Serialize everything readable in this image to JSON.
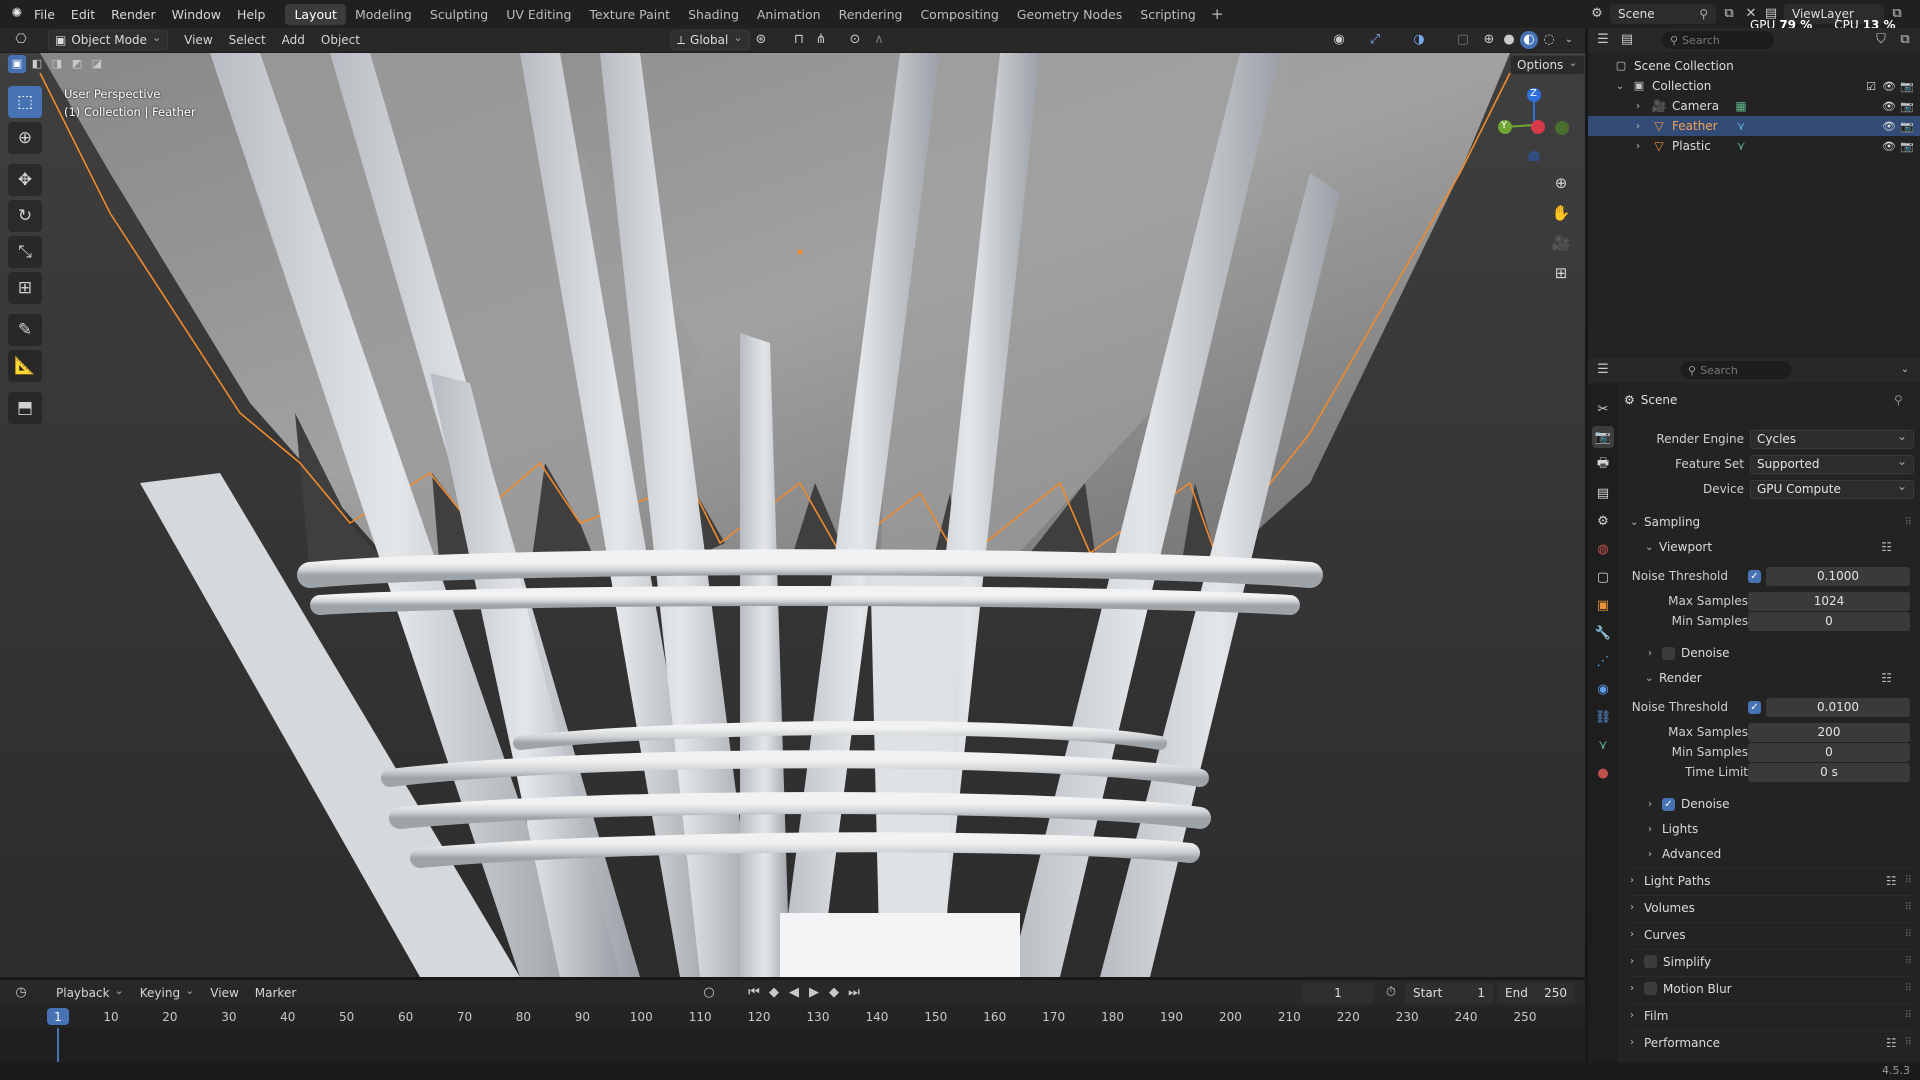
{
  "menu": [
    "File",
    "Edit",
    "Render",
    "Window",
    "Help"
  ],
  "workspace_tabs": [
    "Layout",
    "Modeling",
    "Sculpting",
    "UV Editing",
    "Texture Paint",
    "Shading",
    "Animation",
    "Rendering",
    "Compositing",
    "Geometry Nodes",
    "Scripting"
  ],
  "scene_name": "Scene",
  "view_layer": "ViewLayer",
  "gpu_label": "GPU",
  "gpu_value": "79 %",
  "cpu_label": "CPU",
  "cpu_value": "13 %",
  "viewport": {
    "mode": "Object Mode",
    "menus": [
      "View",
      "Select",
      "Add",
      "Object"
    ],
    "orientation": "Global",
    "options_label": "Options",
    "overlay_line1": "User Perspective",
    "overlay_line2": "(1) Collection | Feather",
    "gizmo_axes": [
      "Z",
      "Y"
    ],
    "tools": [
      "select-box-icon",
      "cursor-icon",
      "move-icon",
      "rotate-icon",
      "scale-icon",
      "transform-icon",
      "annotate-icon",
      "measure-icon",
      "add-cube-icon"
    ]
  },
  "outliner": {
    "search_placeholder": "Search",
    "root": "Scene Collection",
    "collection": "Collection",
    "items": [
      {
        "name": "Camera",
        "selected": false,
        "color": "#e8943a"
      },
      {
        "name": "Feather",
        "selected": true,
        "color": "#e8943a"
      },
      {
        "name": "Plastic",
        "selected": false,
        "color": "#e8943a"
      }
    ]
  },
  "properties": {
    "search_placeholder": "Search",
    "context": "Scene",
    "render_engine_label": "Render Engine",
    "render_engine": "Cycles",
    "feature_set_label": "Feature Set",
    "feature_set": "Supported",
    "device_label": "Device",
    "device": "GPU Compute",
    "sampling": "Sampling",
    "viewport_panel": "Viewport",
    "noise_threshold_label": "Noise Threshold",
    "vp_noise_threshold": "0.1000",
    "max_samples_label": "Max Samples",
    "vp_max_samples": "1024",
    "min_samples_label": "Min Samples",
    "vp_min_samples": "0",
    "denoise_label": "Denoise",
    "render_panel": "Render",
    "r_noise_threshold": "0.0100",
    "r_max_samples": "200",
    "r_min_samples": "0",
    "time_limit_label": "Time Limit",
    "r_time_limit": "0 s",
    "lights": "Lights",
    "advanced": "Advanced",
    "sections": [
      "Light Paths",
      "Volumes",
      "Curves",
      "Simplify",
      "Motion Blur",
      "Film",
      "Performance"
    ]
  },
  "timeline": {
    "menus": [
      "Playback",
      "Keying",
      "View",
      "Marker"
    ],
    "current_frame": "1",
    "start_label": "Start",
    "start": "1",
    "end_label": "End",
    "end": "250",
    "ticks": [
      "1",
      "10",
      "20",
      "30",
      "40",
      "50",
      "60",
      "70",
      "80",
      "90",
      "100",
      "110",
      "120",
      "130",
      "140",
      "150",
      "160",
      "170",
      "180",
      "190",
      "200",
      "210",
      "220",
      "230",
      "240",
      "250"
    ]
  },
  "version": "4.5.3",
  "colors": {
    "accent": "#4772b3",
    "selection_outline": "#f08a2c",
    "header": "#282828",
    "panel": "#232323"
  }
}
